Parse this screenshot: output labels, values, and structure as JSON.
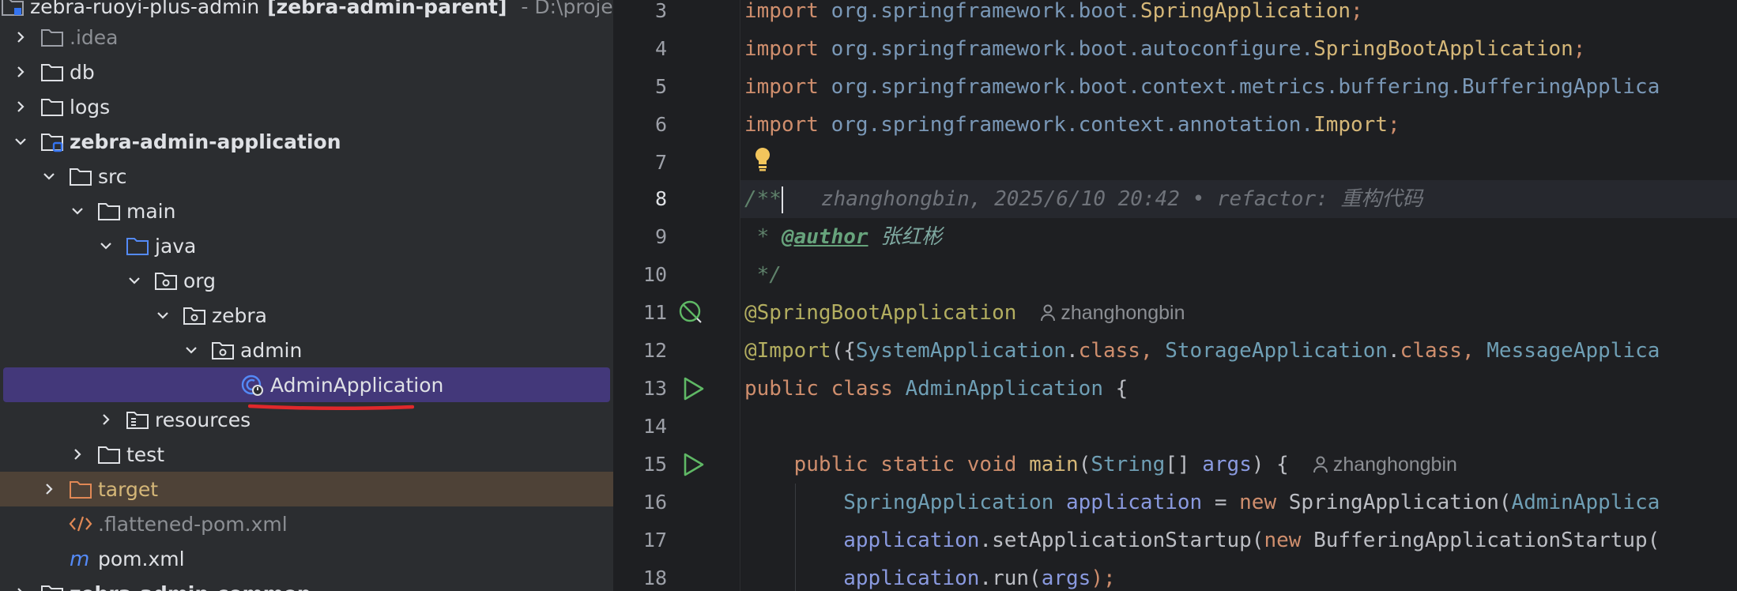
{
  "project_header": {
    "name": "zebra-ruoyi-plus-admin",
    "module": "[zebra-admin-parent]",
    "path": "- D:\\project\\fra"
  },
  "tree": [
    {
      "label": ".idea",
      "type": "folder",
      "expanded": false,
      "style": "dim"
    },
    {
      "label": "db",
      "type": "folder",
      "expanded": false
    },
    {
      "label": "logs",
      "type": "folder",
      "expanded": false
    },
    {
      "label": "zebra-admin-application",
      "type": "module",
      "expanded": true,
      "style": "bold"
    },
    {
      "label": "src",
      "type": "folder",
      "expanded": true
    },
    {
      "label": "main",
      "type": "folder",
      "expanded": true
    },
    {
      "label": "java",
      "type": "source-folder",
      "expanded": true
    },
    {
      "label": "org",
      "type": "package",
      "expanded": true
    },
    {
      "label": "zebra",
      "type": "package",
      "expanded": true
    },
    {
      "label": "admin",
      "type": "package",
      "expanded": true
    },
    {
      "label": "AdminApplication",
      "type": "spring-boot-class",
      "selected": true
    },
    {
      "label": "resources",
      "type": "resources-folder",
      "expanded": false
    },
    {
      "label": "test",
      "type": "folder",
      "expanded": false
    },
    {
      "label": "target",
      "type": "excluded-folder",
      "expanded": false,
      "style": "orange"
    },
    {
      "label": ".flattened-pom.xml",
      "type": "xml-file",
      "style": "dim"
    },
    {
      "label": "pom.xml",
      "type": "maven-file"
    },
    {
      "label": "zebra-admin-common",
      "type": "module",
      "style": "bold"
    }
  ],
  "editor": {
    "line_numbers": [
      "3",
      "4",
      "5",
      "6",
      "7",
      "8",
      "9",
      "10",
      "11",
      "12",
      "13",
      "14",
      "15",
      "16",
      "17",
      "18"
    ],
    "current_line": "8",
    "lines": {
      "l3": {
        "kw": "import",
        "pkg": "org.springframework.boot.",
        "cls": "SpringApplication",
        "end": ";"
      },
      "l4": {
        "kw": "import",
        "pkg": "org.springframework.boot.autoconfigure.",
        "cls": "SpringBootApplication",
        "end": ";"
      },
      "l5": {
        "kw": "import",
        "pkg": "org.springframework.boot.context.metrics.buffering.",
        "cls": "BufferingApplica"
      },
      "l6": {
        "kw": "import",
        "pkg": "org.springframework.context.annotation.",
        "cls": "Import",
        "end": ";"
      },
      "l8": {
        "doc": "/**",
        "blame": "zhanghongbin, 2025/6/10 20:42 • refactor: 重构代码"
      },
      "l9": {
        "star": " * ",
        "tag": "@author",
        "value": " 张红彬"
      },
      "l10": {
        "end": " */"
      },
      "l11": {
        "ann": "@SpringBootApplication",
        "author": "zhanghongbin"
      },
      "l12": {
        "ann": "@Import",
        "open": "({",
        "c1": "SystemApplication",
        "dot1": ".",
        "k1": "class",
        "sep1": ", ",
        "c2": "StorageApplication",
        "dot2": ".",
        "k2": "class",
        "sep2": ", ",
        "c3": "MessageApplica"
      },
      "l13": {
        "kw1": "public",
        "kw2": "class",
        "name": "AdminApplication",
        "brace": " {"
      },
      "l15": {
        "kw1": "public",
        "kw2": "static",
        "kw3": "void",
        "name": "main",
        "open": "(",
        "type": "String",
        "arr": "[] ",
        "param": "args",
        "close": ") {",
        "author": "zhanghongbin"
      },
      "l16": {
        "type": "SpringApplication",
        "var": " application",
        "eq": " = ",
        "kw": "new",
        "cls": " SpringApplication(",
        "arg": "AdminApplica"
      },
      "l17": {
        "var": "application",
        "call": ".setApplicationStartup(",
        "kw": "new",
        "cls": " BufferingApplicationStartup("
      },
      "l18": {
        "var": "application",
        "call": ".run(",
        "arg": "args",
        "end": ");"
      }
    }
  },
  "colors": {
    "selection": "#43387a",
    "excluded_row": "#4e4237",
    "underline_mark": "#e0282b",
    "keyword": "#cf8e6d",
    "annotation": "#b3ae60"
  }
}
